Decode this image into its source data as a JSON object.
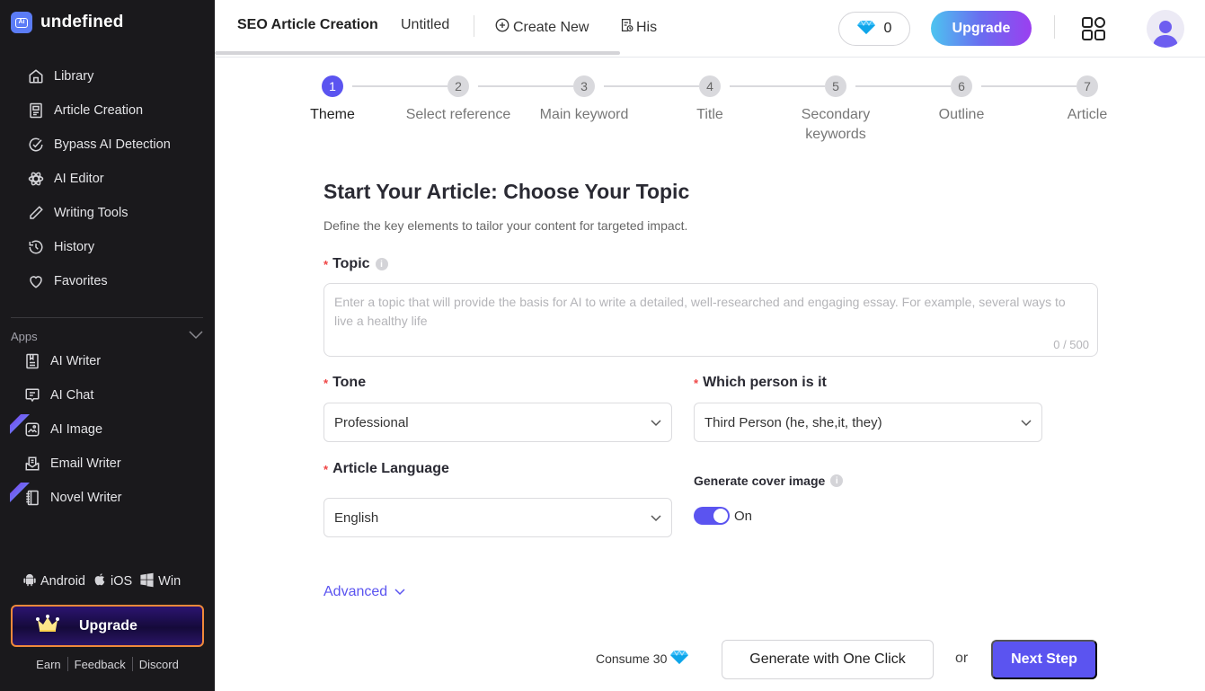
{
  "sidebar": {
    "brand": "undefined",
    "nav": [
      {
        "label": "Library",
        "icon": "home-icon"
      },
      {
        "label": "Article Creation",
        "icon": "document-icon"
      },
      {
        "label": "Bypass AI Detection",
        "icon": "check-circle-icon"
      },
      {
        "label": "AI Editor",
        "icon": "atom-icon"
      },
      {
        "label": "Writing Tools",
        "icon": "pencil-icon"
      },
      {
        "label": "History",
        "icon": "history-icon"
      },
      {
        "label": "Favorites",
        "icon": "heart-icon"
      }
    ],
    "apps_label": "Apps",
    "apps": [
      {
        "label": "AI Writer",
        "icon": "writer-icon",
        "new": false
      },
      {
        "label": "AI Chat",
        "icon": "chat-icon",
        "new": false
      },
      {
        "label": "AI Image",
        "icon": "image-icon",
        "new": true
      },
      {
        "label": "Email Writer",
        "icon": "email-icon",
        "new": false
      },
      {
        "label": "Novel Writer",
        "icon": "notebook-icon",
        "new": true
      }
    ],
    "new_badge": "NEW",
    "platforms": {
      "android": "Android",
      "ios": "iOS",
      "win": "Win"
    },
    "upgrade_label": "Upgrade",
    "footer_links": {
      "earn": "Earn",
      "feedback": "Feedback",
      "discord": "Discord"
    }
  },
  "topbar": {
    "title": "SEO Article Creation",
    "doc_name": "Untitled",
    "create_new": "Create New",
    "history": "His",
    "gems": "0",
    "upgrade_label": "Upgrade"
  },
  "stepper": {
    "active_step": 1,
    "steps": [
      {
        "num": "1",
        "label": "Theme"
      },
      {
        "num": "2",
        "label": "Select reference"
      },
      {
        "num": "3",
        "label": "Main keyword"
      },
      {
        "num": "4",
        "label": "Title"
      },
      {
        "num": "5",
        "label": "Secondary keywords"
      },
      {
        "num": "6",
        "label": "Outline"
      },
      {
        "num": "7",
        "label": "Article"
      }
    ]
  },
  "form": {
    "heading": "Start Your Article: Choose Your Topic",
    "subheading": "Define the key elements to tailor your content for targeted impact.",
    "topic": {
      "label": "Topic",
      "value": "",
      "placeholder": "Enter a topic that will provide the basis for AI to write a detailed, well-researched and engaging essay. For example, several ways to live a healthy life",
      "counter": "0 / 500"
    },
    "tone": {
      "label": "Tone",
      "value": "Professional"
    },
    "person": {
      "label": "Which person is it",
      "value": "Third Person (he, she,it, they)"
    },
    "language": {
      "label": "Article Language",
      "value": "English"
    },
    "cover_image": {
      "label": "Generate cover image",
      "state": "On",
      "enabled": true
    },
    "advanced_label": "Advanced"
  },
  "footer": {
    "consume": "Consume 30",
    "generate_label": "Generate with One Click",
    "or": "or",
    "next_label": "Next Step"
  },
  "colors": {
    "accent": "#5b54f0",
    "sidebar_bg": "#1a191c",
    "upgrade_border": "#f0893a"
  }
}
